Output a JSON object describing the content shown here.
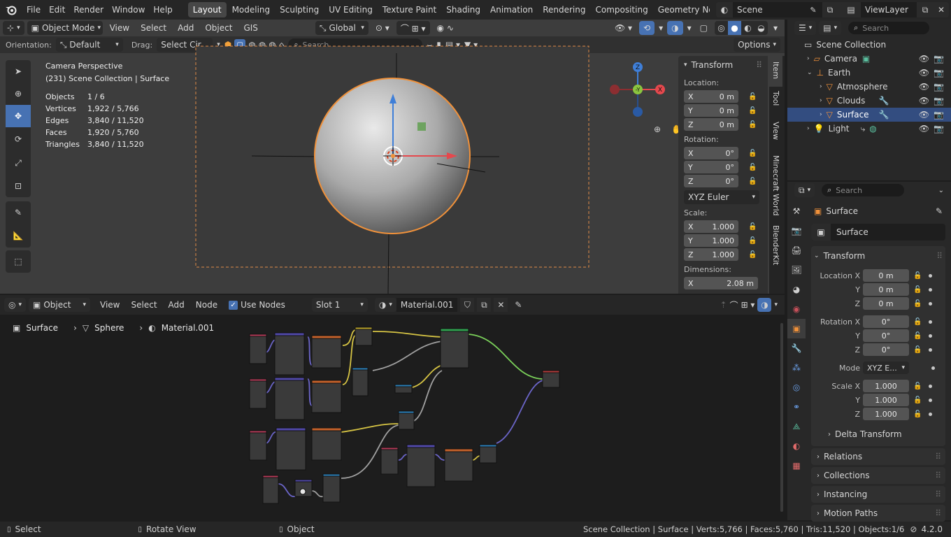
{
  "topbar": {
    "menus": [
      "File",
      "Edit",
      "Render",
      "Window",
      "Help"
    ],
    "workspaces": [
      "Layout",
      "Modeling",
      "Sculpting",
      "UV Editing",
      "Texture Paint",
      "Shading",
      "Animation",
      "Rendering",
      "Compositing",
      "Geometry Nod"
    ],
    "active_workspace": "Layout",
    "scene_name": "Scene",
    "view_layer": "ViewLayer"
  },
  "viewport_header": {
    "mode": "Object Mode",
    "menus": [
      "View",
      "Select",
      "Add",
      "Object",
      "GIS"
    ],
    "transform_orientation": "Global"
  },
  "tool_settings": {
    "orientation_label": "Orientation:",
    "orientation_value": "Default",
    "drag_label": "Drag:",
    "drag_value": "Select Cir...",
    "search_placeholder": "Search",
    "options_label": "Options"
  },
  "viewport_overlay": {
    "title": "Camera Perspective",
    "subtitle": "(231) Scene Collection | Surface",
    "stats": [
      {
        "label": "Objects",
        "value": "1 / 6"
      },
      {
        "label": "Vertices",
        "value": "1,922 / 5,766"
      },
      {
        "label": "Edges",
        "value": "3,840 / 11,520"
      },
      {
        "label": "Faces",
        "value": "1,920 / 5,760"
      },
      {
        "label": "Triangles",
        "value": "3,840 / 11,520"
      }
    ],
    "gizmo_labels": {
      "x": "X",
      "y": "-Y",
      "z": "Z"
    }
  },
  "n_panel": {
    "header": "Transform",
    "location_label": "Location:",
    "location": [
      {
        "axis": "X",
        "value": "0 m"
      },
      {
        "axis": "Y",
        "value": "0 m"
      },
      {
        "axis": "Z",
        "value": "0 m"
      }
    ],
    "rotation_label": "Rotation:",
    "rotation": [
      {
        "axis": "X",
        "value": "0°"
      },
      {
        "axis": "Y",
        "value": "0°"
      },
      {
        "axis": "Z",
        "value": "0°"
      }
    ],
    "rotation_mode": "XYZ Euler",
    "scale_label": "Scale:",
    "scale": [
      {
        "axis": "X",
        "value": "1.000"
      },
      {
        "axis": "Y",
        "value": "1.000"
      },
      {
        "axis": "Z",
        "value": "1.000"
      }
    ],
    "dimensions_label": "Dimensions:",
    "dimensions": [
      {
        "axis": "X",
        "value": "2.08 m"
      }
    ],
    "tabs": [
      "Item",
      "Tool",
      "View",
      "Minecraft World",
      "BlenderKit"
    ]
  },
  "outliner": {
    "search_placeholder": "Search",
    "root": "Scene Collection",
    "items": [
      {
        "name": "Camera",
        "indent": 0
      },
      {
        "name": "Earth",
        "indent": 0
      },
      {
        "name": "Atmosphere",
        "indent": 1
      },
      {
        "name": "Clouds",
        "indent": 1
      },
      {
        "name": "Surface",
        "indent": 1,
        "selected": true
      },
      {
        "name": "Light",
        "indent": 0
      }
    ]
  },
  "node_editor": {
    "editor_type": "Object",
    "menus": [
      "View",
      "Select",
      "Add",
      "Node"
    ],
    "use_nodes_label": "Use Nodes",
    "slot": "Slot 1",
    "material": "Material.001",
    "breadcrumb": [
      "Surface",
      "Sphere",
      "Material.001"
    ]
  },
  "properties": {
    "search_placeholder": "Search",
    "object_name": "Surface",
    "object_field": "Surface",
    "transform_header": "Transform",
    "location": [
      {
        "label": "Location X",
        "value": "0 m"
      },
      {
        "label": "Y",
        "value": "0 m"
      },
      {
        "label": "Z",
        "value": "0 m"
      }
    ],
    "rotation": [
      {
        "label": "Rotation X",
        "value": "0°"
      },
      {
        "label": "Y",
        "value": "0°"
      },
      {
        "label": "Z",
        "value": "0°"
      }
    ],
    "mode_label": "Mode",
    "mode_value": "XYZ E...",
    "scale": [
      {
        "label": "Scale X",
        "value": "1.000"
      },
      {
        "label": "Y",
        "value": "1.000"
      },
      {
        "label": "Z",
        "value": "1.000"
      }
    ],
    "delta_transform": "Delta Transform",
    "panels": [
      "Relations",
      "Collections",
      "Instancing",
      "Motion Paths"
    ]
  },
  "statusbar": {
    "left": [
      {
        "icon": "mouse-left-icon",
        "text": "Select"
      },
      {
        "icon": "mouse-middle-icon",
        "text": "Rotate View"
      },
      {
        "icon": "mouse-right-icon",
        "text": "Object"
      }
    ],
    "right": "Scene Collection | Surface | Verts:5,766 | Faces:5,760 | Tris:11,520 | Objects:1/6",
    "version": "4.2.0"
  },
  "colors": {
    "accent": "#4772b3",
    "selection_orange": "#f0913a",
    "x_axis": "#e5484d",
    "y_axis": "#8bc53f",
    "z_axis": "#3f7fd8"
  }
}
